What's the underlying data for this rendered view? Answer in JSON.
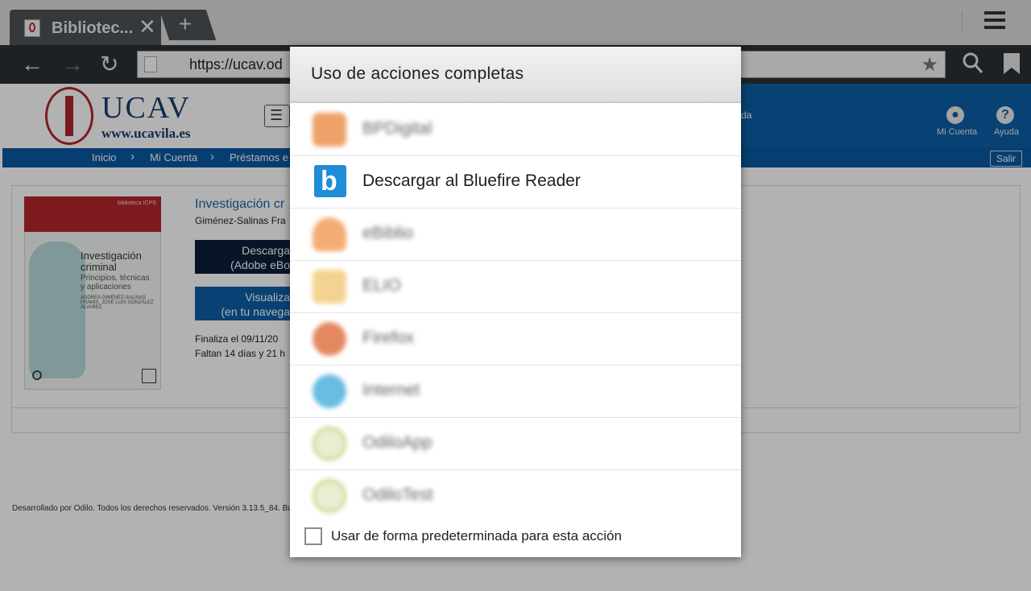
{
  "browser": {
    "tab_title": "Bibliotec...",
    "tab_close": "✕",
    "new_tab": "+",
    "url": "https://ucav.od"
  },
  "site": {
    "logo_text": "UCAV",
    "logo_url": "www.ucavila.es",
    "header_link_partial": "da",
    "account_label": "Mi Cuenta",
    "help_label": "Ayuda",
    "breadcrumbs": [
      "Inicio",
      "Mi Cuenta",
      "Préstamos e"
    ],
    "logout_label": "Salir"
  },
  "book": {
    "cover_series": "biblioteca ICPS",
    "cover_title": "Investigación criminal",
    "cover_subtitle": "Principios, técnicas y aplicaciones",
    "cover_authors": "ANDREA GIMÉNEZ-SALINAS FRAMIS, JOSÉ LUIS GONZÁLEZ ÁLVAREZ",
    "title": "Investigación cr",
    "author": "Giménez-Salinas Fra",
    "download_btn_line1": "Descarga",
    "download_btn_line2": "(Adobe eBo",
    "view_btn_line1": "Visualiza",
    "view_btn_line2": "(en tu navega",
    "ends": "Finaliza el 09/11/20",
    "remaining": "Faltan 14 días y 21 h"
  },
  "footer_text": "Desarrollado por Odilo. Todos los derechos reservados. Versión 3.13.5_84. Bu",
  "dialog": {
    "title": "Uso de acciones completas",
    "items": [
      {
        "label": "BPDigital",
        "color": "#e87a2a"
      },
      {
        "label": "Descargar al Bluefire Reader",
        "color": "#1e8ed6"
      },
      {
        "label": "eBiblio",
        "color": "#f08a3a"
      },
      {
        "label": "ELIO",
        "color": "#f0c060"
      },
      {
        "label": "Firefox",
        "color": "#d9571c"
      },
      {
        "label": "Internet",
        "color": "#2aa0d8"
      },
      {
        "label": "OdiloApp",
        "color": "#b0c040"
      },
      {
        "label": "OdiloTest",
        "color": "#b0c040"
      }
    ],
    "default_checkbox_label": "Usar de forma predeterminada para esta acción"
  }
}
